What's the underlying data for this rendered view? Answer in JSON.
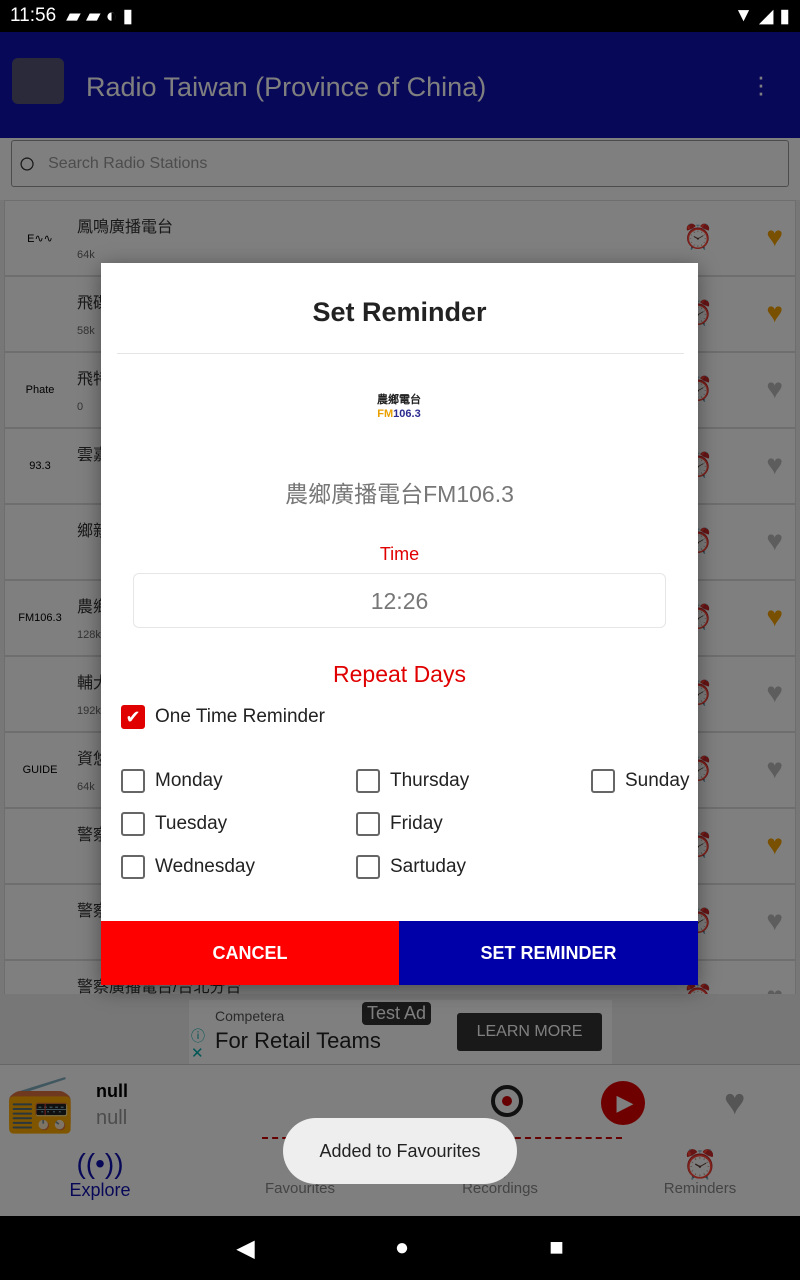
{
  "status": {
    "time": "11:56"
  },
  "appbar": {
    "title": "Radio Taiwan (Province of China)"
  },
  "search": {
    "placeholder": "Search Radio Stations"
  },
  "stations": [
    {
      "name": "鳳鳴廣播電台",
      "bitrate": "64k",
      "favourite": true,
      "logo": "E∿∿"
    },
    {
      "name": "飛碟",
      "bitrate": "58k",
      "favourite": true,
      "logo": ""
    },
    {
      "name": "飛特",
      "bitrate": "0",
      "favourite": false,
      "logo": "Phate"
    },
    {
      "name": "雲嘉",
      "bitrate": "",
      "favourite": false,
      "logo": "93.3"
    },
    {
      "name": "鄉親",
      "bitrate": "",
      "favourite": false,
      "logo": ""
    },
    {
      "name": "農鄉",
      "bitrate": "128k",
      "favourite": true,
      "logo": "FM106.3"
    },
    {
      "name": "輔大",
      "bitrate": "192k",
      "favourite": false,
      "logo": ""
    },
    {
      "name": "資悠",
      "bitrate": "64k",
      "favourite": false,
      "logo": "GUIDE"
    },
    {
      "name": "警察",
      "bitrate": "",
      "favourite": true,
      "logo": ""
    },
    {
      "name": "警察",
      "bitrate": "",
      "favourite": false,
      "logo": ""
    },
    {
      "name": "警察廣播電台/台北分台",
      "bitrate": "",
      "favourite": false,
      "logo": ""
    }
  ],
  "dialog": {
    "title": "Set Reminder",
    "station_logo": "農鄉電台 FM106.3",
    "station_name": "農鄉廣播電台FM106.3",
    "time_label": "Time",
    "time_value": "12:26",
    "repeat_label": "Repeat Days",
    "one_time": {
      "label": "One Time Reminder",
      "checked": true
    },
    "days": [
      {
        "label": "Monday",
        "checked": false
      },
      {
        "label": "Tuesday",
        "checked": false
      },
      {
        "label": "Wednesday",
        "checked": false
      },
      {
        "label": "Thursday",
        "checked": false
      },
      {
        "label": "Friday",
        "checked": false
      },
      {
        "label": "Sartuday",
        "checked": false
      },
      {
        "label": "Sunday",
        "checked": false
      }
    ],
    "cancel": "CANCEL",
    "set": "SET REMINDER"
  },
  "ad": {
    "badge": "Test Ad",
    "advertiser": "Competera",
    "headline": "For Retail Teams",
    "cta": "LEARN MORE"
  },
  "player": {
    "title": "null",
    "subtitle": "null"
  },
  "nav": [
    {
      "label": "Explore",
      "active": true
    },
    {
      "label": "Favourites"
    },
    {
      "label": "Recordings"
    },
    {
      "label": "Reminders"
    }
  ],
  "toast": "Added to Favourites",
  "colors": {
    "primary": "#0000a8",
    "accent": "#ff0000",
    "favourite": "#f2a000"
  }
}
